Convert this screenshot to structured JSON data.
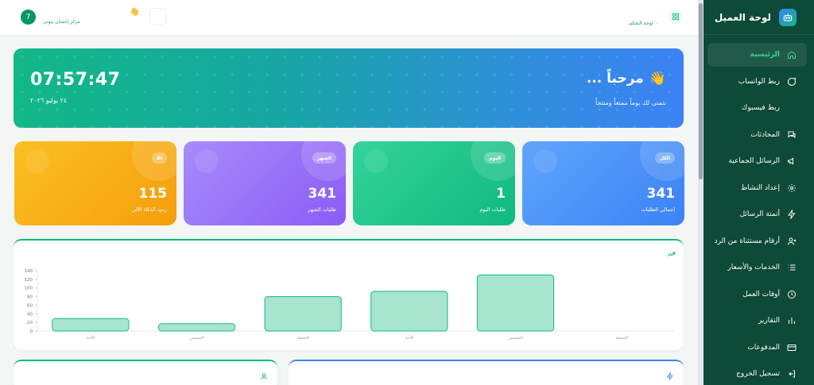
{
  "sidebar": {
    "title": "لوحة العميل",
    "logo_icon": "robot-icon",
    "items": [
      {
        "label": "الرئيسية",
        "icon": "home-icon",
        "active": true
      },
      {
        "label": "ربط الواتساب",
        "icon": "chat-bubble-icon"
      },
      {
        "label": "ربط فيسبوك",
        "icon": ""
      },
      {
        "label": "المحادثات",
        "icon": "conversations-icon"
      },
      {
        "label": "الرسائل الجماعية",
        "icon": "megaphone-icon"
      },
      {
        "label": "إعداد النشاط",
        "icon": "gear-icon"
      },
      {
        "label": "أتمتة الرسائل",
        "icon": "lightning-icon"
      },
      {
        "label": "أرقام مستثناة من الرد",
        "icon": "user-x-icon"
      },
      {
        "label": "الخدمات والأسعار",
        "icon": "list-icon"
      },
      {
        "label": "أوقات العمل",
        "icon": "clock-icon"
      },
      {
        "label": "التقارير",
        "icon": "bar-chart-icon"
      },
      {
        "label": "المدفوعات",
        "icon": "credit-card-icon"
      },
      {
        "label": "تسجيل الخروج",
        "icon": "logout-icon"
      }
    ]
  },
  "header": {
    "breadcrumb_home": "لوحة التحكم",
    "breadcrumb_sep": "›",
    "user_initial": "7",
    "center_name": "مركز إحسان بيوتي"
  },
  "banner": {
    "greeting": "مرحباً ...",
    "wave": "👋",
    "wish": "نتمنى لك يوماً ممتعاً ومنتجاً",
    "time": "07:57:47",
    "date": "٢٤ يوليو ٢٠٢٦"
  },
  "stats": [
    {
      "badge": "الكل",
      "value": "341",
      "label": "إجمالي الطلبات",
      "color": "#3b82f6"
    },
    {
      "badge": "اليوم",
      "value": "1",
      "label": "طلبات اليوم",
      "color": "#10b981"
    },
    {
      "badge": "الشهر",
      "value": "341",
      "label": "طلبات الشهر",
      "color": "#8b5cf6"
    },
    {
      "badge": "AI",
      "value": "115",
      "label": "ردود الذكاء الآلي",
      "color": "#f59e0b"
    }
  ],
  "colors": {
    "sidebar_bg": "#0d4a37",
    "accent": "#10b981",
    "bar_fill": "#a7e5cf",
    "bar_stroke": "#10b981"
  },
  "chart_data": {
    "type": "bar",
    "categories": [
      "الأحد",
      "الخميس",
      "الجمعة",
      "الأحد",
      "الخميس",
      "الجمعة"
    ],
    "values": [
      29,
      17,
      80,
      92,
      130,
      0
    ],
    "ylim": [
      0,
      140
    ],
    "yticks": [
      0,
      20,
      40,
      60,
      80,
      100,
      120,
      140
    ],
    "grid": false
  }
}
